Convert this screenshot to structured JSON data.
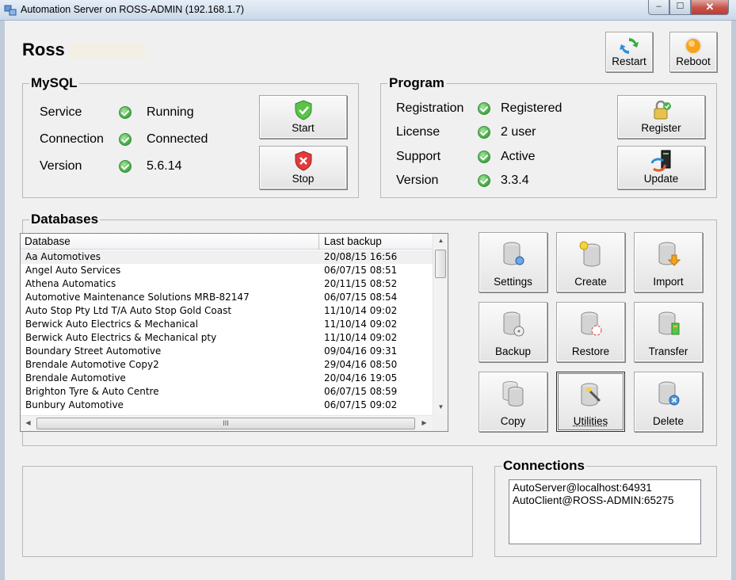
{
  "window": {
    "title": "Automation Server on ROSS-ADMIN (192.168.1.7)",
    "buttons": {
      "minimize": "–",
      "maximize": "☐",
      "close": "✕"
    }
  },
  "header": {
    "title": "Ross",
    "restart_label": "Restart",
    "reboot_label": "Reboot"
  },
  "mysql": {
    "title": "MySQL",
    "rows": [
      {
        "label": "Service",
        "value": "Running"
      },
      {
        "label": "Connection",
        "value": "Connected"
      },
      {
        "label": "Version",
        "value": "5.6.14"
      }
    ],
    "start_label": "Start",
    "stop_label": "Stop"
  },
  "program": {
    "title": "Program",
    "rows": [
      {
        "label": "Registration",
        "value": "Registered"
      },
      {
        "label": "License",
        "value": "2 user"
      },
      {
        "label": "Support",
        "value": "Active"
      },
      {
        "label": "Version",
        "value": "3.3.4"
      }
    ],
    "register_label": "Register",
    "update_label": "Update"
  },
  "databases": {
    "title": "Databases",
    "columns": [
      "Database",
      "Last backup"
    ],
    "rows": [
      {
        "name": "Aa Automotives",
        "backup": "20/08/15 16:56"
      },
      {
        "name": "Angel Auto Services",
        "backup": "06/07/15 08:51"
      },
      {
        "name": "Athena Automatics",
        "backup": "20/11/15 08:52"
      },
      {
        "name": "Automotive Maintenance Solutions MRB-82147",
        "backup": "06/07/15 08:54"
      },
      {
        "name": "Auto Stop Pty Ltd T/A Auto Stop Gold Coast",
        "backup": "11/10/14 09:02"
      },
      {
        "name": "Berwick Auto Electrics & Mechanical",
        "backup": "11/10/14 09:02"
      },
      {
        "name": "Berwick Auto Electrics & Mechanical pty",
        "backup": "11/10/14 09:02"
      },
      {
        "name": "Boundary Street Automotive",
        "backup": "09/04/16 09:31"
      },
      {
        "name": "Brendale Automotive Copy2",
        "backup": "29/04/16 08:50"
      },
      {
        "name": "Brendale Automotive",
        "backup": "20/04/16 19:05"
      },
      {
        "name": "Brighton Tyre & Auto Centre",
        "backup": "06/07/15 08:59"
      },
      {
        "name": "Bunbury Automotive",
        "backup": "06/07/15 09:02"
      }
    ],
    "scroll_grip": "III",
    "actions": [
      {
        "label": "Settings",
        "icon": "db-settings-icon"
      },
      {
        "label": "Create",
        "icon": "db-create-icon"
      },
      {
        "label": "Import",
        "icon": "db-import-icon"
      },
      {
        "label": "Backup",
        "icon": "db-backup-icon"
      },
      {
        "label": "Restore",
        "icon": "db-restore-icon"
      },
      {
        "label": "Transfer",
        "icon": "db-transfer-icon"
      },
      {
        "label": "Copy",
        "icon": "db-copy-icon"
      },
      {
        "label": "Utilities",
        "icon": "db-utilities-icon"
      },
      {
        "label": "Delete",
        "icon": "db-delete-icon"
      }
    ]
  },
  "connections": {
    "title": "Connections",
    "items": [
      "AutoServer@localhost:64931",
      "AutoClient@ROSS-ADMIN:65275"
    ]
  },
  "colors": {
    "status_ok": "#4bb04b",
    "window_bg": "#f0f0f0",
    "accent_blue": "#3a7bd5"
  }
}
